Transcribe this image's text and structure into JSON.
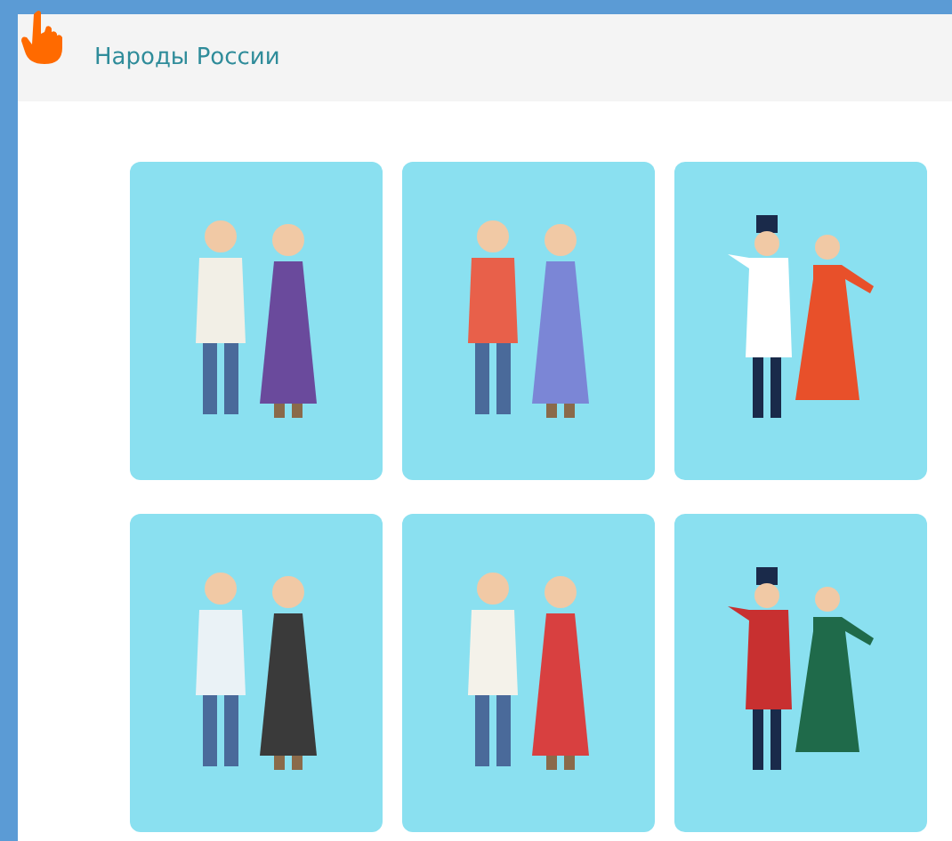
{
  "header": {
    "title": "Народы России"
  },
  "cards": [
    {
      "kind": "standing"
    },
    {
      "kind": "standing"
    },
    {
      "kind": "dancing"
    },
    {
      "kind": "standing"
    },
    {
      "kind": "standing"
    },
    {
      "kind": "dancing"
    }
  ]
}
